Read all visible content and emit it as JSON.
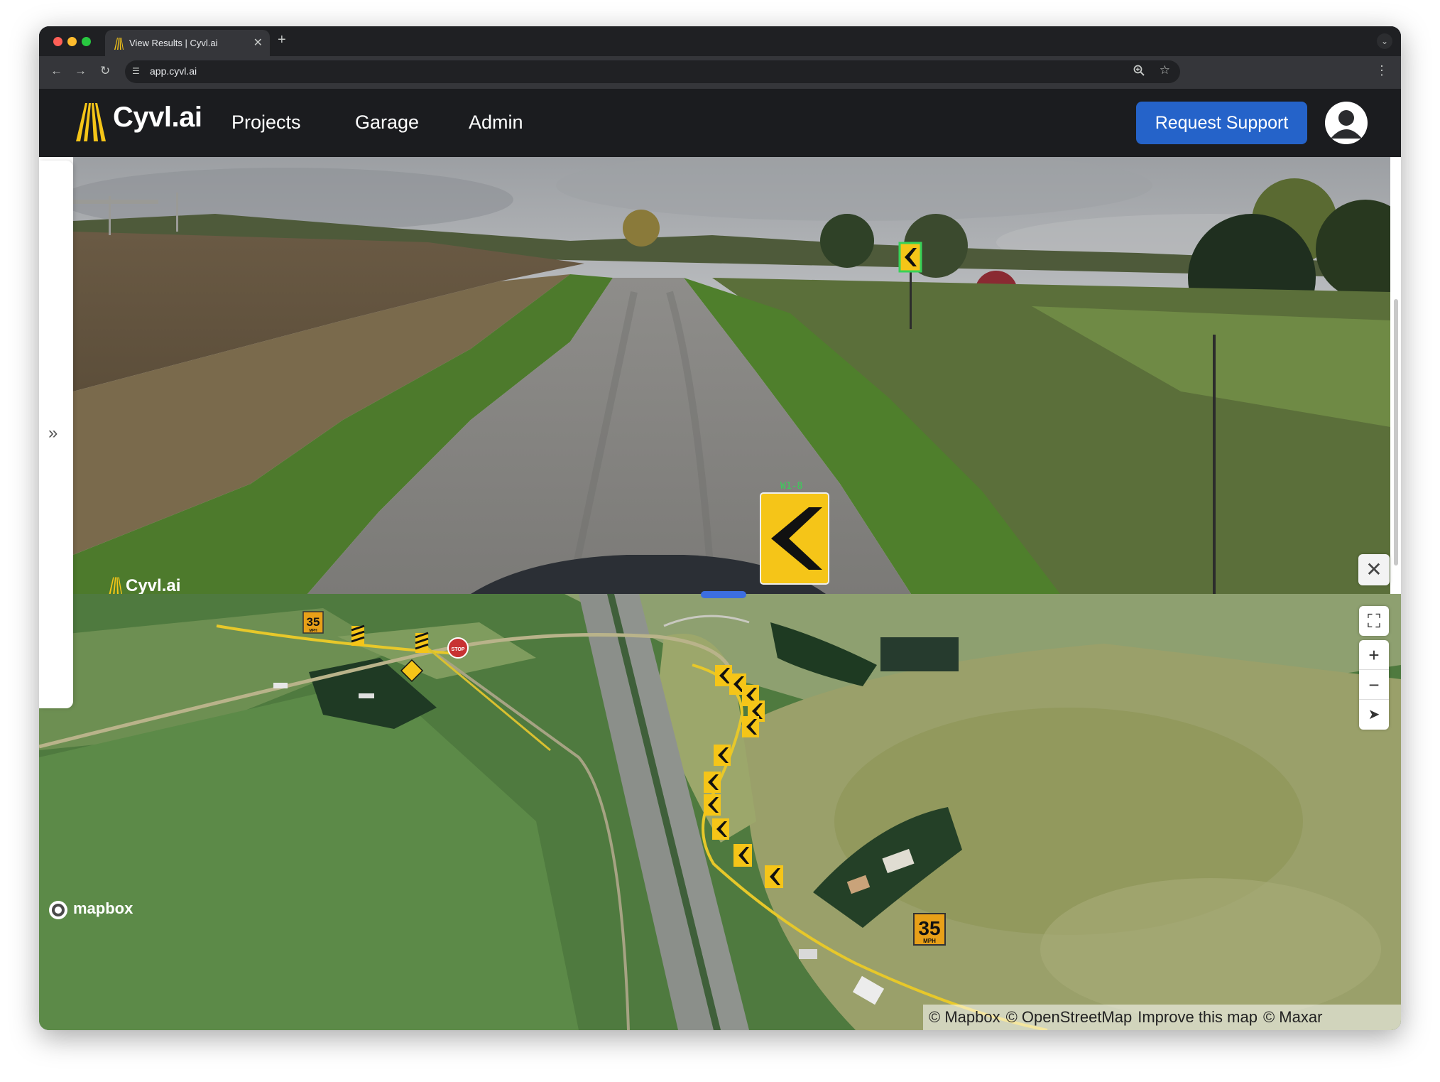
{
  "browser": {
    "tab_title": "View Results | Cyvl.ai",
    "url": "app.cyvl.ai",
    "icons": {
      "back": "back-arrow-icon",
      "forward": "forward-arrow-icon",
      "reload": "reload-icon",
      "site_info": "tune-icon",
      "zoom": "zoom-icon",
      "bookmark": "star-icon",
      "menu": "kebab-menu-icon"
    }
  },
  "app": {
    "brand": "Cyvl.ai",
    "brand_color": "#f5c518",
    "nav": [
      {
        "label": "Projects"
      },
      {
        "label": "Garage"
      },
      {
        "label": "Admin"
      }
    ],
    "support_button": "Request Support",
    "accent": "#2563c9"
  },
  "viewer": {
    "detection_label": "W1-8",
    "watermark": "Cyvl.ai"
  },
  "map": {
    "speed_sign_value": "35",
    "speed_sign_unit": "MPH",
    "stop_sign_text": "STOP",
    "mapbox_logo_text": "mapbox",
    "attribution": [
      "© Mapbox",
      "© OpenStreetMap",
      "Improve this map",
      "© Maxar"
    ]
  }
}
